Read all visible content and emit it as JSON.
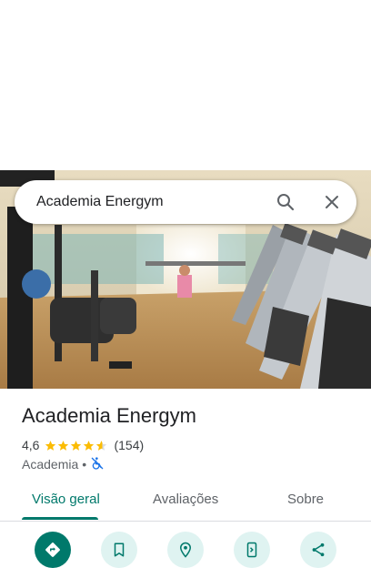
{
  "search": {
    "query": "Academia Energym"
  },
  "place": {
    "name": "Academia Energym",
    "rating": "4,6",
    "rating_value": 4.6,
    "reviews": "(154)",
    "category": "Academia",
    "separator": "•"
  },
  "tabs": [
    {
      "label": "Visão geral",
      "active": true
    },
    {
      "label": "Avaliações",
      "active": false
    },
    {
      "label": "Sobre",
      "active": false
    }
  ],
  "actions": [
    {
      "icon": "directions-icon"
    },
    {
      "icon": "bookmark-icon"
    },
    {
      "icon": "nearby-icon"
    },
    {
      "icon": "send-to-phone-icon"
    },
    {
      "icon": "share-icon"
    }
  ],
  "colors": {
    "accent": "#00796b",
    "star": "#fbbc04",
    "action_bg": "#dff3f1"
  }
}
